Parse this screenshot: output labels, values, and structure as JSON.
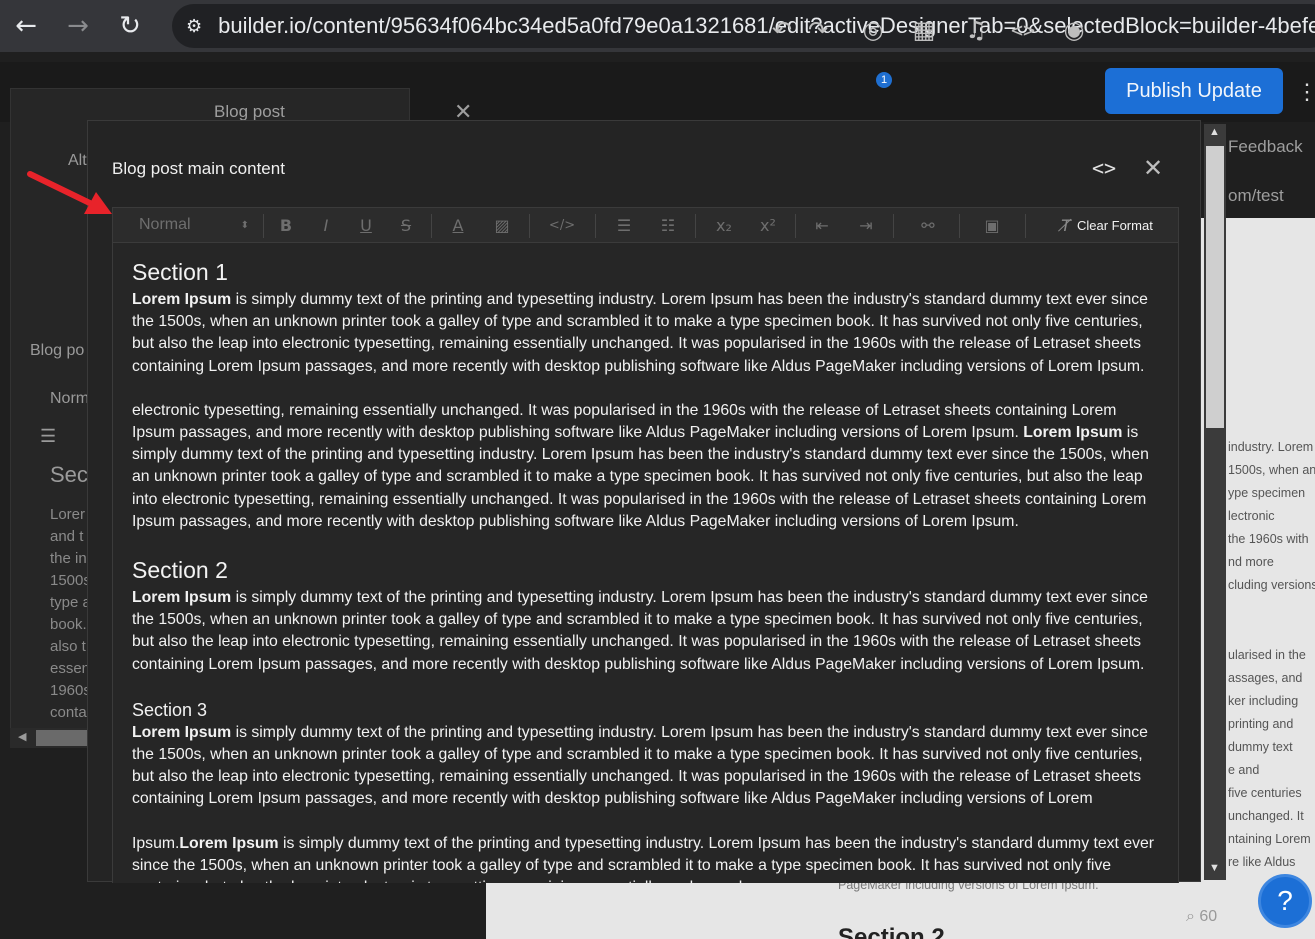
{
  "browser": {
    "url": "builder.io/content/95634f064bc34ed5a0fd79e0a1321681/edit?activeDesignerTab=0&selectedBlock=builder-4befe02d",
    "icons": [
      "back-arrow-icon",
      "forward-arrow-icon",
      "reload-icon",
      "site-settings-icon"
    ]
  },
  "topbar": {
    "publish_label": "Publish Update",
    "notification_count": "1",
    "feedback_label": "Feedback",
    "url_fragment": "om/test",
    "icons": [
      "undo-icon",
      "redo-icon",
      "target-icon",
      "calendar-icon",
      "bell-icon",
      "code-icon",
      "eye-icon",
      "more-icon"
    ]
  },
  "left_panel": {
    "title": "Blog post",
    "alt_fragment": "Alt",
    "section_label": "Blog po",
    "format_fragment": "Norm",
    "heading_fragment": "Sec",
    "lines": [
      "Lorer",
      "and t",
      "the in",
      "1500s",
      "type a",
      "book.",
      "also t",
      "essen",
      "1960s",
      "conta"
    ]
  },
  "modal": {
    "title": "Blog post main content",
    "toolbar": {
      "format_select": "Normal",
      "clear_format_label": "Clear Format"
    },
    "content": {
      "s1_heading": "Section 1",
      "bold": "Lorem Ipsum",
      "p1": " is simply dummy text of the printing and typesetting industry. Lorem Ipsum has been the industry's standard dummy text ever since the 1500s, when an unknown printer took a galley of type and scrambled it to make a type specimen book. It has survived not only five centuries, but also the leap into electronic typesetting, remaining essentially unchanged. It was popularised in the 1960s with the release of Letraset sheets containing Lorem Ipsum passages, and more recently with desktop publishing software like Aldus PageMaker including versions of Lorem Ipsum.",
      "p2a": "electronic typesetting, remaining essentially unchanged. It was popularised in the 1960s with the release of Letraset sheets containing Lorem Ipsum passages, and more recently with desktop publishing software like Aldus PageMaker including versions of Lorem Ipsum. ",
      "p2b": " is simply dummy text of the printing and typesetting industry. Lorem Ipsum has been the industry's standard dummy text ever since the 1500s, when an unknown printer took a galley of type and scrambled it to make a type specimen book. It has survived not only five centuries, but also the leap into electronic typesetting, remaining essentially unchanged. It was popularised in the 1960s with the release of Letraset sheets containing Lorem Ipsum passages, and more recently with desktop publishing software like Aldus PageMaker including versions of Lorem Ipsum.",
      "s2_heading": "Section 2",
      "p3": " is simply dummy text of the printing and typesetting industry. Lorem Ipsum has been the industry's standard dummy text ever since the 1500s, when an unknown printer took a galley of type and scrambled it to make a type specimen book. It has survived not only five centuries, but also the leap into electronic typesetting, remaining essentially unchanged. It was popularised in the 1960s with the release of Letraset sheets containing Lorem Ipsum passages, and more recently with desktop publishing software like Aldus PageMaker including versions of Lorem Ipsum.",
      "s3_heading": "Section 3",
      "p4": " is simply dummy text of the printing and typesetting industry. Lorem Ipsum has been the industry's standard dummy text ever since the 1500s, when an unknown printer took a galley of type and scrambled it to make a type specimen book. It has survived not only five centuries, but also the leap into electronic typesetting, remaining essentially unchanged. It was popularised in the 1960s with the release of Letraset sheets containing Lorem Ipsum passages, and more recently with desktop publishing software like Aldus PageMaker including versions of Lorem",
      "p5a": "Ipsum.",
      "p5b": " is simply dummy text of the printing and typesetting industry. Lorem Ipsum has been the industry's standard dummy text ever since the 1500s, when an unknown printer took a galley of type and scrambled it to make a type specimen book. It has survived not only five centuries, but also the leap into electronic typesetting, remaining essentially unchanged."
    }
  },
  "preview": {
    "lines_a": [
      "industry. Lorem",
      "1500s, when an",
      "ype specimen",
      "lectronic",
      "the 1960s with",
      "nd more",
      "cluding versions"
    ],
    "lines_b": [
      "ularised in the",
      "assages, and",
      "ker including",
      "printing and",
      "dummy text",
      "e and",
      "five centuries",
      "unchanged. It",
      "ntaining Lorem",
      "re like Aldus"
    ],
    "caption": "PageMaker including versions of Lorem Ipsum.",
    "bottom_heading": "Section 2",
    "zoom": "60"
  },
  "colors": {
    "accent": "#1c6fd6",
    "modal_bg": "#242424",
    "arrow": "#e8232a"
  }
}
